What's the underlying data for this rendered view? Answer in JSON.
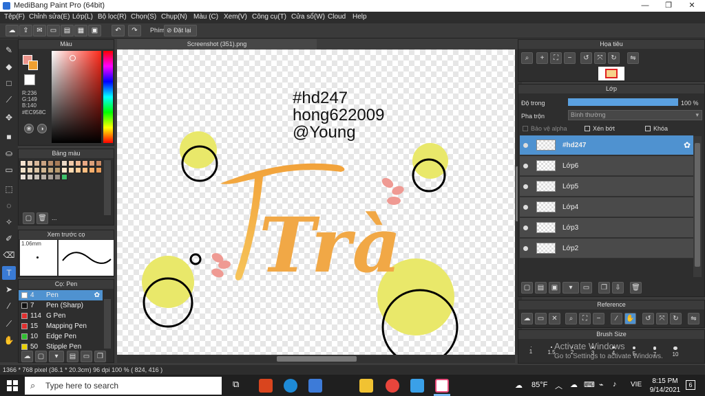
{
  "window": {
    "title": "MediBang Paint Pro (64bit)",
    "minimize": "—",
    "maximize": "❐",
    "close": "✕"
  },
  "menu": [
    "Tệp(F)",
    "Chỉnh sửa(E)",
    "Lớp(L)",
    "Bộ lọc(R)",
    "Chọn(S)",
    "Chụp(N)",
    "Màu (C)",
    "Xem(V)",
    "Công cụ(T)",
    "Cửa sổ(W)",
    "Cloud",
    "Help"
  ],
  "toolbar": {
    "phim_label": "Phím",
    "reset_label": "Đặt lại"
  },
  "document_tab": "Screenshot (351).png",
  "color_panel": {
    "title": "Màu",
    "r": "R:236",
    "g": "G:149",
    "b": "B:140",
    "hex": "#EC958C",
    "primary_color": "#EC958C"
  },
  "palette_panel": {
    "title": "Bảng màu",
    "more": "..."
  },
  "preview_panel": {
    "title": "Xem trước cọ",
    "size": "1.06mm"
  },
  "brush_panel": {
    "title": "Cọ: Pen",
    "brushes": [
      {
        "size": "4",
        "name": "Pen",
        "color": "#ffffff"
      },
      {
        "size": "7",
        "name": "Pen (Sharp)",
        "color": "#111111"
      },
      {
        "size": "114",
        "name": "G Pen",
        "color": "#e03030"
      },
      {
        "size": "15",
        "name": "Mapping Pen",
        "color": "#e03030"
      },
      {
        "size": "10",
        "name": "Edge Pen",
        "color": "#2fbf2f"
      },
      {
        "size": "50",
        "name": "Stipple Pen",
        "color": "#e8d000"
      }
    ]
  },
  "canvas_text": [
    "#hd247",
    "hong622009",
    "@Young"
  ],
  "canvas_lettering": "Trà",
  "navigator_panel": {
    "title": "Họa tiêu"
  },
  "layer_panel": {
    "title": "Lớp",
    "opacity_label": "Độ trong",
    "opacity_value": "100 %",
    "opacity_fraction": 1.0,
    "blend_label": "Pha trộn",
    "blend_value": "Bình thường",
    "protect_alpha": "Bảo vệ alpha",
    "clipping": "Xén bớt",
    "lock": "Khóa",
    "layers": [
      "#hd247",
      "Lớp6",
      "Lớp5",
      "Lớp4",
      "Lớp3",
      "Lớp2"
    ]
  },
  "reference_panel": {
    "title": "Reference"
  },
  "brush_size_panel": {
    "title": "Brush Size",
    "sizes": [
      "1",
      "1.5",
      "2",
      "3",
      "4",
      "5",
      "7",
      "10"
    ]
  },
  "watermark": {
    "line1": "Activate Windows",
    "line2": "Go to Settings to activate Windows."
  },
  "status": "1366 * 768 pixel  (36.1 * 20.3cm)  96 dpi  100 %  ( 824, 416 )",
  "taskbar": {
    "search_placeholder": "Type here to search",
    "weather": "85°F",
    "lang": "VIE",
    "time": "8:15 PM",
    "date": "9/14/2021",
    "notif": "6"
  }
}
